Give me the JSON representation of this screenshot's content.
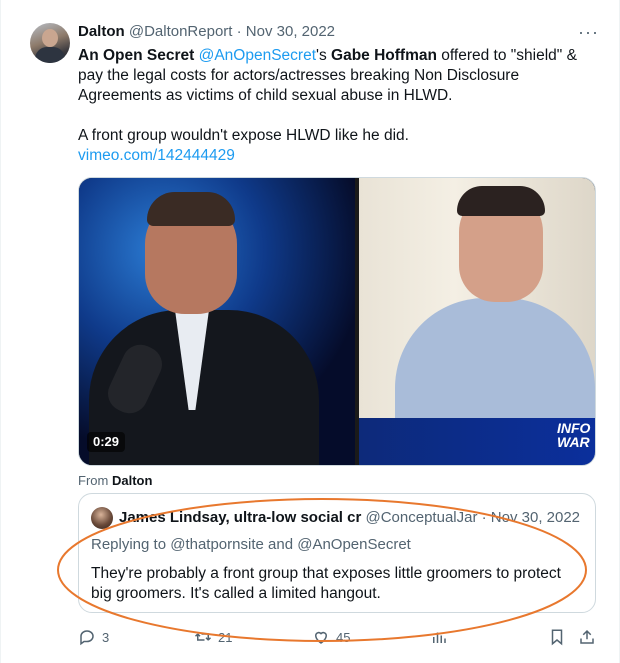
{
  "tweet": {
    "author_name": "Dalton",
    "author_handle": "@DaltonReport",
    "separator": "·",
    "date": "Nov 30, 2022",
    "more_label": "···",
    "body": {
      "part1": "An Open Secret",
      "part2": " ",
      "mention": "@AnOpenSecret",
      "part3": "'s ",
      "part4": "Gabe Hoffman",
      "part5": " offered to \"shield\" & pay the legal costs for actors/actresses breaking Non Disclosure Agreements as victims of child sexual abuse in HLWD.",
      "line2": "A front group wouldn't expose HLWD like he did.",
      "link": "vimeo.com/142444429"
    },
    "media": {
      "duration": "0:29",
      "watermark_line1": "INFO",
      "watermark_line2": "WAR"
    },
    "from_label": "From",
    "from_name": "Dalton"
  },
  "quote": {
    "author_name": "James Lindsay, ultra-low social cr",
    "author_handle": "@ConceptualJar",
    "separator": "·",
    "date": "Nov 30, 2022",
    "replying_prefix": "Replying to",
    "replying_to_1": "@thatpornsite",
    "replying_and": "and",
    "replying_to_2": "@AnOpenSecret",
    "text": "They're probably a front group that exposes little groomers to protect big groomers. It's called a limited hangout."
  },
  "actions": {
    "replies": "3",
    "retweets": "21",
    "likes": "45"
  },
  "colors": {
    "link_blue": "#1d9bf0",
    "muted_gray": "#536471",
    "annotation_orange": "#e8782e"
  }
}
